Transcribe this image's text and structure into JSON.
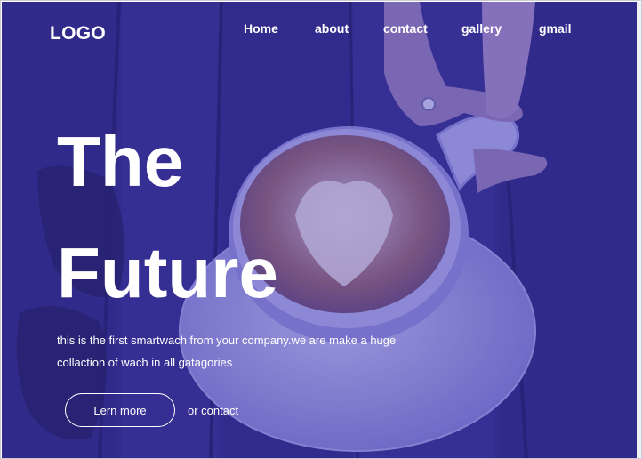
{
  "nav": {
    "logo": "LOGO",
    "links": [
      "Home",
      "about",
      "contact",
      "gallery",
      "gmail"
    ]
  },
  "hero": {
    "title_line1": "The",
    "title_line2": "Future",
    "description": "this is the first smartwach from your company.we are make a huge collaction of wach in all gatagories",
    "cta_label": "Lern more",
    "secondary_label": "or contact"
  },
  "colors": {
    "overlay": "#3b35a6",
    "text": "#ffffff"
  }
}
